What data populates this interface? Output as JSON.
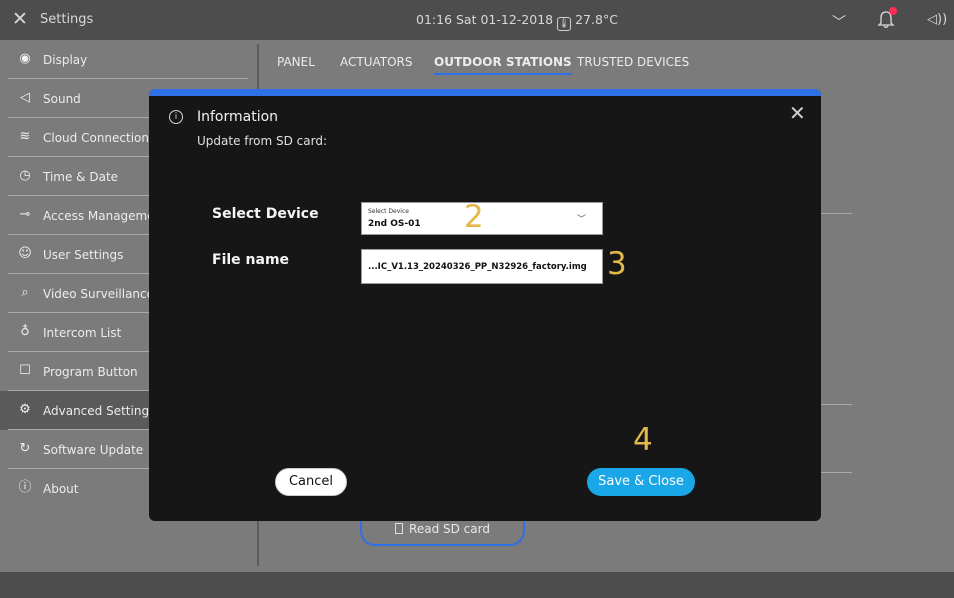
{
  "topbar": {
    "title": "Settings",
    "time_date": "01:16  Sat 01-12-2018",
    "temperature": "27.8°C"
  },
  "sidebar": {
    "items": [
      {
        "label": "Display",
        "icon": "eye-icon"
      },
      {
        "label": "Sound",
        "icon": "speaker-icon"
      },
      {
        "label": "Cloud Connections",
        "icon": "wifi-icon"
      },
      {
        "label": "Time & Date",
        "icon": "clock-icon"
      },
      {
        "label": "Access Management",
        "icon": "key-icon"
      },
      {
        "label": "User Settings",
        "icon": "user-icon"
      },
      {
        "label": "Video Surveillance",
        "icon": "camera-icon"
      },
      {
        "label": "Intercom List",
        "icon": "microphone-icon"
      },
      {
        "label": "Program Button",
        "icon": "square-icon"
      },
      {
        "label": "Advanced Settings",
        "icon": "gear-icon"
      },
      {
        "label": "Software Update",
        "icon": "refresh-icon"
      },
      {
        "label": "About",
        "icon": "info-icon"
      }
    ]
  },
  "tabs": [
    "PANEL",
    "ACTUATORS",
    "OUTDOOR STATIONS",
    "TRUSTED DEVICES"
  ],
  "background": {
    "read_sd_button": "Read SD card"
  },
  "dialog": {
    "title": "Information",
    "subtitle": "Update from SD card:",
    "select_device": {
      "label": "Select Device",
      "caption": "Select Device",
      "value": "2nd OS-01"
    },
    "file_name": {
      "label": "File name",
      "value": "...IC_V1.13_20240326_PP_N32926_factory.img"
    },
    "markers": [
      "2",
      "3",
      "4"
    ],
    "cancel_label": "Cancel",
    "save_label": "Save & Close"
  },
  "colors": {
    "accent": "#2f6fe8",
    "save_button": "#1aa7e8",
    "annotation": "#e2b84a",
    "notification": "#ff2d55"
  }
}
